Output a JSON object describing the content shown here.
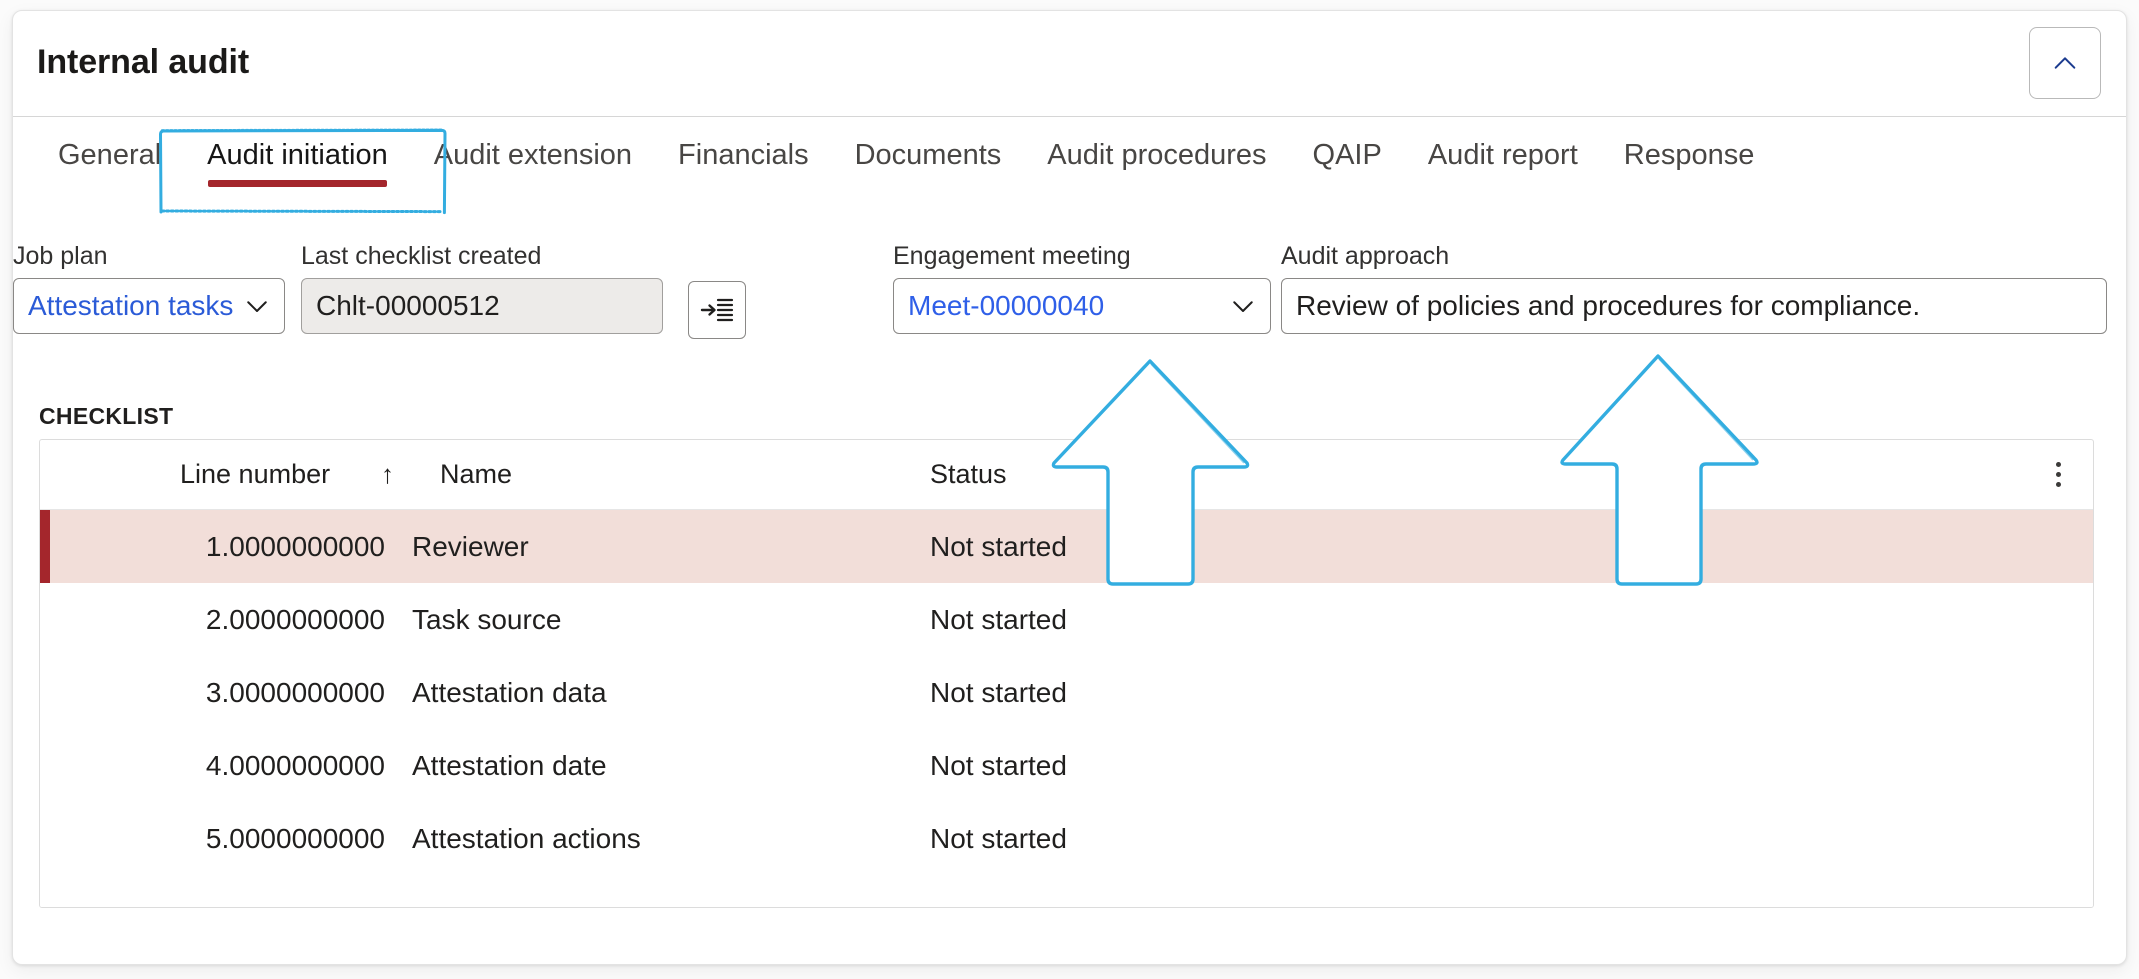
{
  "header": {
    "title": "Internal audit",
    "collapse_icon": "chevron-up-icon"
  },
  "tabs": [
    {
      "label": "General",
      "selected": false
    },
    {
      "label": "Audit initiation",
      "selected": true
    },
    {
      "label": "Audit extension",
      "selected": false
    },
    {
      "label": "Financials",
      "selected": false
    },
    {
      "label": "Documents",
      "selected": false
    },
    {
      "label": "Audit procedures",
      "selected": false
    },
    {
      "label": "QAIP",
      "selected": false
    },
    {
      "label": "Audit report",
      "selected": false
    },
    {
      "label": "Response",
      "selected": false
    }
  ],
  "fields": {
    "job_plan": {
      "label": "Job plan",
      "value": "Attestation tasks",
      "icon": "chevron-down-icon"
    },
    "last_checklist_created": {
      "label": "Last checklist created",
      "value": "Chlt-00000512"
    },
    "goto_checklist_button": {
      "icon": "go-to-list-icon"
    },
    "engagement_meeting": {
      "label": "Engagement meeting",
      "value": "Meet-00000040",
      "icon": "chevron-down-icon"
    },
    "audit_approach": {
      "label": "Audit approach",
      "value": "Review of policies and procedures for compliance."
    }
  },
  "checklist": {
    "caption": "CHECKLIST",
    "columns": {
      "line_number": "Line number",
      "sort_indicator": "↑",
      "name": "Name",
      "status": "Status"
    },
    "overflow_icon": "more-options-icon",
    "rows": [
      {
        "line_number": "1.0000000000",
        "name": "Reviewer",
        "status": "Not started",
        "selected": true
      },
      {
        "line_number": "2.0000000000",
        "name": "Task source",
        "status": "Not started",
        "selected": false
      },
      {
        "line_number": "3.0000000000",
        "name": "Attestation data",
        "status": "Not started",
        "selected": false
      },
      {
        "line_number": "4.0000000000",
        "name": "Attestation date",
        "status": "Not started",
        "selected": false
      },
      {
        "line_number": "5.0000000000",
        "name": "Attestation actions",
        "status": "Not started",
        "selected": false
      }
    ]
  },
  "annotations": {
    "tab_highlight": {
      "shape": "rectangle",
      "color": "#33ade0",
      "target": "Audit initiation"
    },
    "arrows": [
      {
        "shape": "arrow-up",
        "color": "#33ade0",
        "target": "Engagement meeting"
      },
      {
        "shape": "arrow-up",
        "color": "#33ade0",
        "target": "Audit approach"
      }
    ]
  },
  "colors": {
    "accent_red": "#a4262c",
    "selected_row_bg": "#f2ded9",
    "link_blue": "#2b5bd7",
    "annotation_blue": "#33ade0",
    "readonly_bg": "#edebe9"
  }
}
